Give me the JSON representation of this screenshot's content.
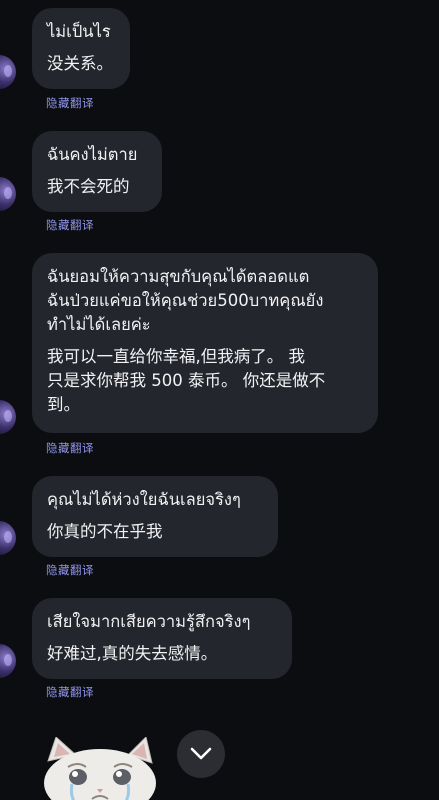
{
  "hide_translation_label": "隐藏翻译",
  "messages": [
    {
      "original": "ไม่เป็นไร",
      "translation": "没关系。"
    },
    {
      "original": "ฉันคงไม่ตาย",
      "translation": "我不会死的"
    },
    {
      "original": "ฉันยอมให้ความสุขกับคุณได้ตลอดแต\nฉันป่วยแค่ขอให้คุณช่วย500บาทคุณยัง\nทำไม่ได้เลยค่ะ",
      "translation": "我可以一直给你幸福,但我病了。 我\n只是求你帮我 500 泰币。 你还是做不\n到。"
    },
    {
      "original": "คุณไม่ได้ห่วงใยฉันเลยจริงๆ",
      "translation": "你真的不在乎我"
    },
    {
      "original": "เสียใจมากเสียความรู้สึกจริงๆ",
      "translation": "好难过,真的失去感情。"
    }
  ],
  "colors": {
    "background": "#0c0d11",
    "bubble": "#24262d",
    "link": "#8e93e6",
    "text": "#f2f2f4"
  },
  "icons": {
    "scroll_down": "chevron-down-icon",
    "sticker": "crying-cat-sticker"
  }
}
